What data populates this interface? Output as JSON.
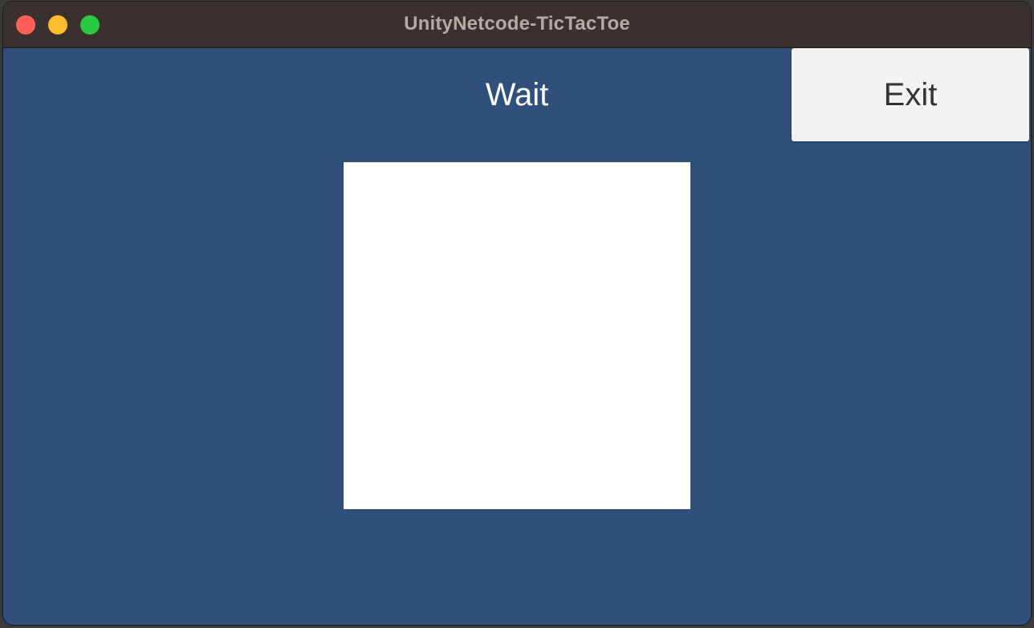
{
  "window": {
    "title": "UnityNetcode-TicTacToe",
    "traffic_lights": [
      {
        "name": "close",
        "color": "#ff5f57"
      },
      {
        "name": "minimize",
        "color": "#febc2e"
      },
      {
        "name": "zoom",
        "color": "#28c840"
      }
    ]
  },
  "game": {
    "status_text": "Wait",
    "exit_label": "Exit",
    "background_color": "#30507b",
    "board_color": "#ffffff"
  }
}
